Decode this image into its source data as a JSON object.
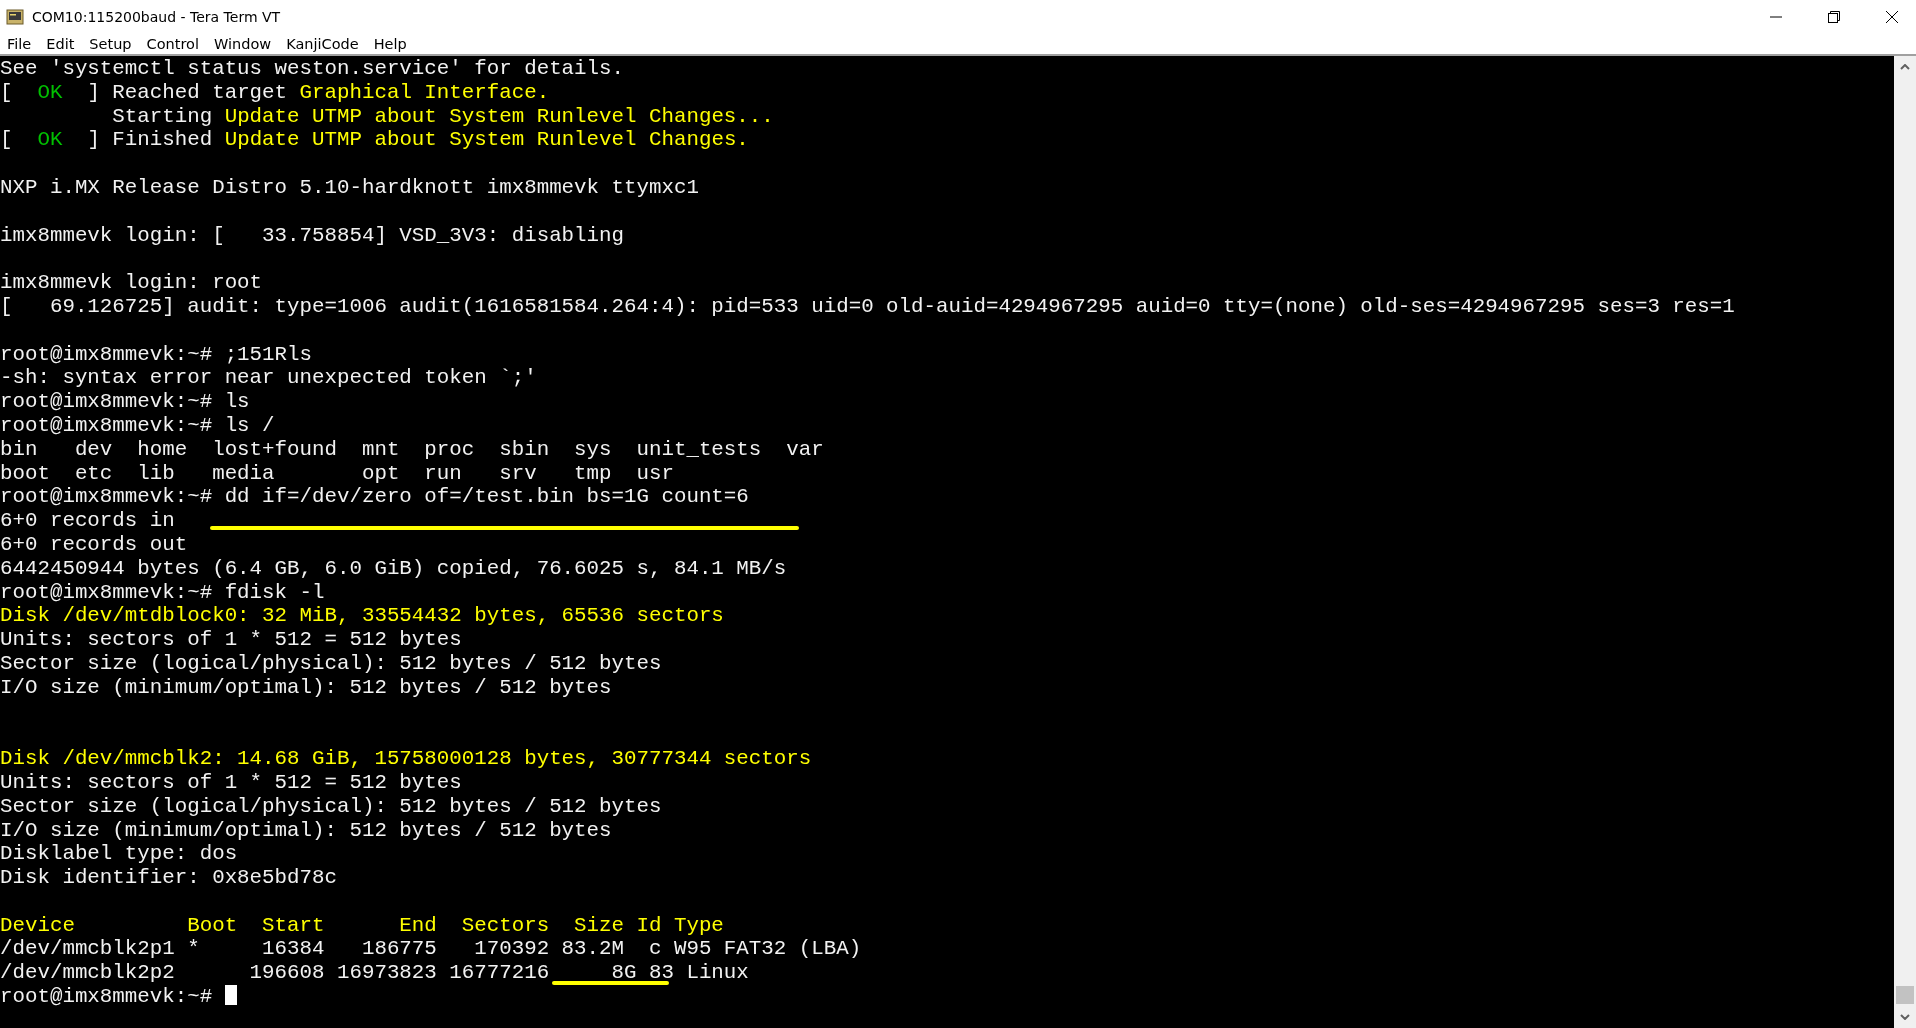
{
  "window": {
    "title": "COM10:115200baud - Tera Term VT"
  },
  "menu": [
    {
      "label": "File"
    },
    {
      "label": "Edit"
    },
    {
      "label": "Setup"
    },
    {
      "label": "Control"
    },
    {
      "label": "Window"
    },
    {
      "label": "KanjiCode"
    },
    {
      "label": "Help"
    }
  ],
  "terminal": {
    "lines": [
      {
        "kind": "text",
        "segments": [
          {
            "kind": "plain",
            "text": "See 'systemctl status weston.service' for details."
          }
        ]
      },
      {
        "kind": "text",
        "segments": [
          {
            "kind": "plain",
            "text": "[  "
          },
          {
            "kind": "ok",
            "text": "OK"
          },
          {
            "kind": "plain",
            "text": "  ] Reached target "
          },
          {
            "kind": "highlight",
            "text": "Graphical Interface."
          }
        ]
      },
      {
        "kind": "text",
        "segments": [
          {
            "kind": "plain",
            "text": "         Starting "
          },
          {
            "kind": "highlight",
            "text": "Update UTMP about System Runlevel Changes..."
          }
        ]
      },
      {
        "kind": "text",
        "segments": [
          {
            "kind": "plain",
            "text": "[  "
          },
          {
            "kind": "ok",
            "text": "OK"
          },
          {
            "kind": "plain",
            "text": "  ] Finished "
          },
          {
            "kind": "highlight",
            "text": "Update UTMP about System Runlevel Changes."
          }
        ]
      },
      {
        "kind": "blank"
      },
      {
        "kind": "text",
        "segments": [
          {
            "kind": "plain",
            "text": "NXP i.MX Release Distro 5.10-hardknott imx8mmevk ttymxc1"
          }
        ]
      },
      {
        "kind": "blank"
      },
      {
        "kind": "text",
        "segments": [
          {
            "kind": "plain",
            "text": "imx8mmevk login: [   33.758854] VSD_3V3: disabling"
          }
        ]
      },
      {
        "kind": "blank"
      },
      {
        "kind": "text",
        "segments": [
          {
            "kind": "plain",
            "text": "imx8mmevk login: root"
          }
        ]
      },
      {
        "kind": "text",
        "segments": [
          {
            "kind": "plain",
            "text": "[   69.126725] audit: type=1006 audit(1616581584.264:4): pid=533 uid=0 old-auid=4294967295 auid=0 tty=(none) old-ses=4294967295 ses=3 res=1"
          }
        ]
      },
      {
        "kind": "blank"
      },
      {
        "kind": "text",
        "segments": [
          {
            "kind": "plain",
            "text": "root@imx8mmevk:~# ;151Rls"
          }
        ]
      },
      {
        "kind": "text",
        "segments": [
          {
            "kind": "plain",
            "text": "-sh: syntax error near unexpected token `;'"
          }
        ]
      },
      {
        "kind": "text",
        "segments": [
          {
            "kind": "plain",
            "text": "root@imx8mmevk:~# ls"
          }
        ]
      },
      {
        "kind": "text",
        "segments": [
          {
            "kind": "plain",
            "text": "root@imx8mmevk:~# ls /"
          }
        ]
      },
      {
        "kind": "text",
        "segments": [
          {
            "kind": "plain",
            "text": "bin   dev  home  lost+found  mnt  proc  sbin  sys  unit_tests  var"
          }
        ]
      },
      {
        "kind": "text",
        "segments": [
          {
            "kind": "plain",
            "text": "boot  etc  lib   media       opt  run   srv   tmp  usr"
          }
        ]
      },
      {
        "kind": "text",
        "segments": [
          {
            "kind": "plain",
            "text": "root@imx8mmevk:~# dd if=/dev/zero of=/test.bin bs=1G count=6"
          }
        ]
      },
      {
        "kind": "text",
        "underlined": true,
        "segments": [
          {
            "kind": "plain",
            "text": "6+0 records in"
          }
        ]
      },
      {
        "kind": "text",
        "segments": [
          {
            "kind": "plain",
            "text": "6+0 records out"
          }
        ]
      },
      {
        "kind": "text",
        "segments": [
          {
            "kind": "plain",
            "text": "6442450944 bytes (6.4 GB, 6.0 GiB) copied, 76.6025 s, 84.1 MB/s"
          }
        ]
      },
      {
        "kind": "text",
        "segments": [
          {
            "kind": "plain",
            "text": "root@imx8mmevk:~# fdisk -l"
          }
        ]
      },
      {
        "kind": "text",
        "segments": [
          {
            "kind": "highlight",
            "text": "Disk /dev/mtdblock0: 32 MiB, 33554432 bytes, 65536 sectors"
          }
        ]
      },
      {
        "kind": "text",
        "segments": [
          {
            "kind": "plain",
            "text": "Units: sectors of 1 * 512 = 512 bytes"
          }
        ]
      },
      {
        "kind": "text",
        "segments": [
          {
            "kind": "plain",
            "text": "Sector size (logical/physical): 512 bytes / 512 bytes"
          }
        ]
      },
      {
        "kind": "text",
        "segments": [
          {
            "kind": "plain",
            "text": "I/O size (minimum/optimal): 512 bytes / 512 bytes"
          }
        ]
      },
      {
        "kind": "blank"
      },
      {
        "kind": "blank"
      },
      {
        "kind": "text",
        "segments": [
          {
            "kind": "highlight",
            "text": "Disk /dev/mmcblk2: 14.68 GiB, 15758000128 bytes, 30777344 sectors"
          }
        ]
      },
      {
        "kind": "text",
        "segments": [
          {
            "kind": "plain",
            "text": "Units: sectors of 1 * 512 = 512 bytes"
          }
        ]
      },
      {
        "kind": "text",
        "segments": [
          {
            "kind": "plain",
            "text": "Sector size (logical/physical): 512 bytes / 512 bytes"
          }
        ]
      },
      {
        "kind": "text",
        "segments": [
          {
            "kind": "plain",
            "text": "I/O size (minimum/optimal): 512 bytes / 512 bytes"
          }
        ]
      },
      {
        "kind": "text",
        "segments": [
          {
            "kind": "plain",
            "text": "Disklabel type: dos"
          }
        ]
      },
      {
        "kind": "text",
        "segments": [
          {
            "kind": "plain",
            "text": "Disk identifier: 0x8e5bd78c"
          }
        ]
      },
      {
        "kind": "blank"
      },
      {
        "kind": "text",
        "segments": [
          {
            "kind": "highlight",
            "text": "Device         Boot  Start      End  Sectors  Size Id Type"
          }
        ]
      },
      {
        "kind": "text",
        "segments": [
          {
            "kind": "plain",
            "text": "/dev/mmcblk2p1 *     16384   186775   170392 83.2M  c W95 FAT32 (LBA)"
          }
        ]
      },
      {
        "kind": "text",
        "underlined": true,
        "segments": [
          {
            "kind": "plain",
            "text": "/dev/mmcblk2p2      196608 16973823 16777216     8G 83 Linux"
          }
        ]
      },
      {
        "kind": "text",
        "cursor": true,
        "segments": [
          {
            "kind": "plain",
            "text": "root@imx8mmevk:~# "
          }
        ]
      }
    ]
  }
}
